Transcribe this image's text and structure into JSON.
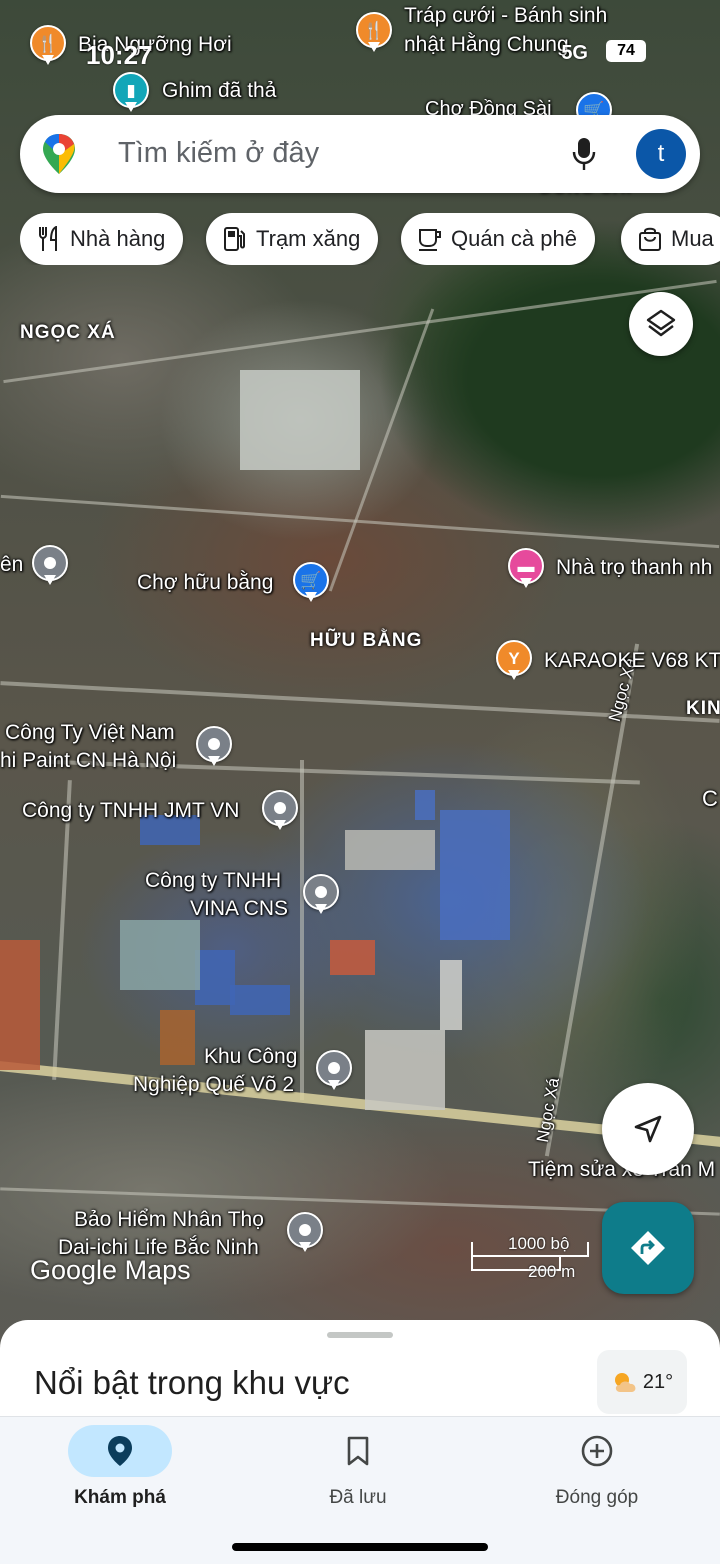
{
  "status_bar": {
    "time": "10:27",
    "signal": "5G",
    "battery": "74"
  },
  "search": {
    "placeholder": "Tìm kiếm ở đây",
    "avatar_letter": "t"
  },
  "chips": [
    {
      "label": "Nhà hàng",
      "icon": "fork-knife-icon"
    },
    {
      "label": "Trạm xăng",
      "icon": "gas-pump-icon"
    },
    {
      "label": "Quán cà phê",
      "icon": "coffee-cup-icon"
    },
    {
      "label": "Mua",
      "icon": "shopping-bag-icon"
    }
  ],
  "map": {
    "places": [
      {
        "label": "Bia Ngưỡng Hơi",
        "icon": "restaurant-icon"
      },
      {
        "label": "Tráp cưới - Bánh sinh",
        "label2": "nhật Hằng Chung",
        "icon": "restaurant-icon"
      },
      {
        "label": "Ghim đã thả",
        "icon": "dropped-pin-icon"
      },
      {
        "label": "Chợ Đồng Sài",
        "icon": "shopping-cart-icon"
      },
      {
        "label": "Chợ hữu bằng",
        "icon": "shopping-cart-icon"
      },
      {
        "label": "Nhà trọ thanh nh",
        "icon": "bed-icon"
      },
      {
        "label": "KARAOKE V68 KT",
        "icon": "cocktail-icon"
      },
      {
        "label": "ên",
        "icon": "place-icon"
      },
      {
        "label": "Công Ty Việt Nam",
        "label2": "hi Paint CN Hà Nội",
        "icon": "place-icon"
      },
      {
        "label": "Công ty TNHH JMT VN",
        "icon": "place-icon"
      },
      {
        "label": "Công ty TNHH",
        "label2": "VINA CNS",
        "icon": "place-icon"
      },
      {
        "label": "Khu Công",
        "label2": "Nghiệp Quế Võ 2",
        "icon": "place-icon"
      },
      {
        "label": "Tiệm sửa xe Trần M",
        "icon": "place-icon"
      },
      {
        "label": "Bảo Hiểm Nhân Thọ",
        "label2": "Dai-ichi Life Bắc Ninh",
        "icon": "place-icon"
      }
    ],
    "area_labels": [
      "NGỌC XÁ",
      "HỮU BẰNG",
      "KIN",
      "ĐỒNG SÀI"
    ],
    "road_labels": [
      "Ngọc Xá",
      "Ngọc Xá"
    ],
    "scale": {
      "imperial": "1000 bộ",
      "metric": "200 m"
    },
    "watermark": "Google Maps",
    "edge_label": "C"
  },
  "sheet": {
    "title": "Nổi bật trong khu vực",
    "temperature": "21°",
    "weather_icon": "partly-cloudy-icon"
  },
  "bottom_nav": {
    "items": [
      {
        "label": "Khám phá",
        "icon": "location-pin-icon",
        "active": true
      },
      {
        "label": "Đã lưu",
        "icon": "bookmark-icon",
        "active": false
      },
      {
        "label": "Đóng góp",
        "icon": "add-circle-icon",
        "active": false
      }
    ]
  },
  "colors": {
    "accent": "#0b57a8",
    "directions_button": "#0e7c8a",
    "active_nav_pill": "#c2e7ff",
    "pin_orange": "#f08a2a",
    "pin_grey": "#7a8088",
    "pin_blue": "#1a73e8",
    "pin_teal": "#12a6b8",
    "pin_pink": "#e64a9c"
  }
}
